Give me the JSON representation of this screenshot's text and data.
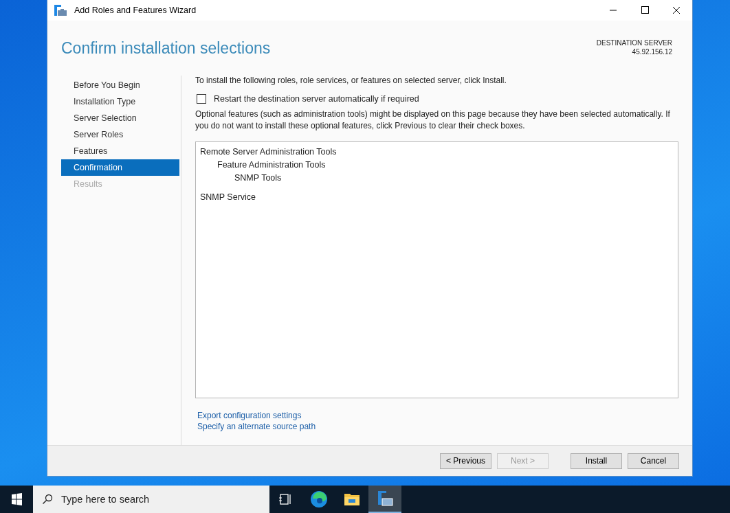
{
  "window": {
    "title": "Add Roles and Features Wizard"
  },
  "header": {
    "title": "Confirm installation selections",
    "server_label": "DESTINATION SERVER",
    "server": "45.92.156.12"
  },
  "nav": [
    {
      "label": "Before You Begin",
      "selected": false,
      "disabled": false
    },
    {
      "label": "Installation Type",
      "selected": false,
      "disabled": false
    },
    {
      "label": "Server Selection",
      "selected": false,
      "disabled": false
    },
    {
      "label": "Server Roles",
      "selected": false,
      "disabled": false
    },
    {
      "label": "Features",
      "selected": false,
      "disabled": false
    },
    {
      "label": "Confirmation",
      "selected": true,
      "disabled": false
    },
    {
      "label": "Results",
      "selected": false,
      "disabled": true
    }
  ],
  "intro": "To install the following roles, role services, or features on selected server, click Install.",
  "restart": {
    "label": "Restart the destination server automatically if required",
    "checked": false
  },
  "note": "Optional features (such as administration tools) might be displayed on this page because they have been selected automatically. If you do not want to install these optional features, click Previous to clear their check boxes.",
  "selections": [
    {
      "label": "Remote Server Administration Tools",
      "children": [
        {
          "label": "Feature Administration Tools",
          "children": [
            {
              "label": "SNMP Tools"
            }
          ]
        }
      ]
    },
    {
      "label": "SNMP Service"
    }
  ],
  "links": [
    "Export configuration settings",
    "Specify an alternate source path"
  ],
  "buttons": [
    {
      "label": "< Previous",
      "disabled": false
    },
    {
      "label": "Next >",
      "disabled": true
    },
    {
      "label": "Install",
      "disabled": false
    },
    {
      "label": "Cancel",
      "disabled": false
    }
  ],
  "taskbar": {
    "search_placeholder": "Type here to search",
    "apps": [
      {
        "kind": "taskview",
        "selected": false
      },
      {
        "kind": "browser",
        "selected": false
      },
      {
        "kind": "folder",
        "selected": false
      },
      {
        "kind": "wizard",
        "selected": true
      }
    ]
  }
}
